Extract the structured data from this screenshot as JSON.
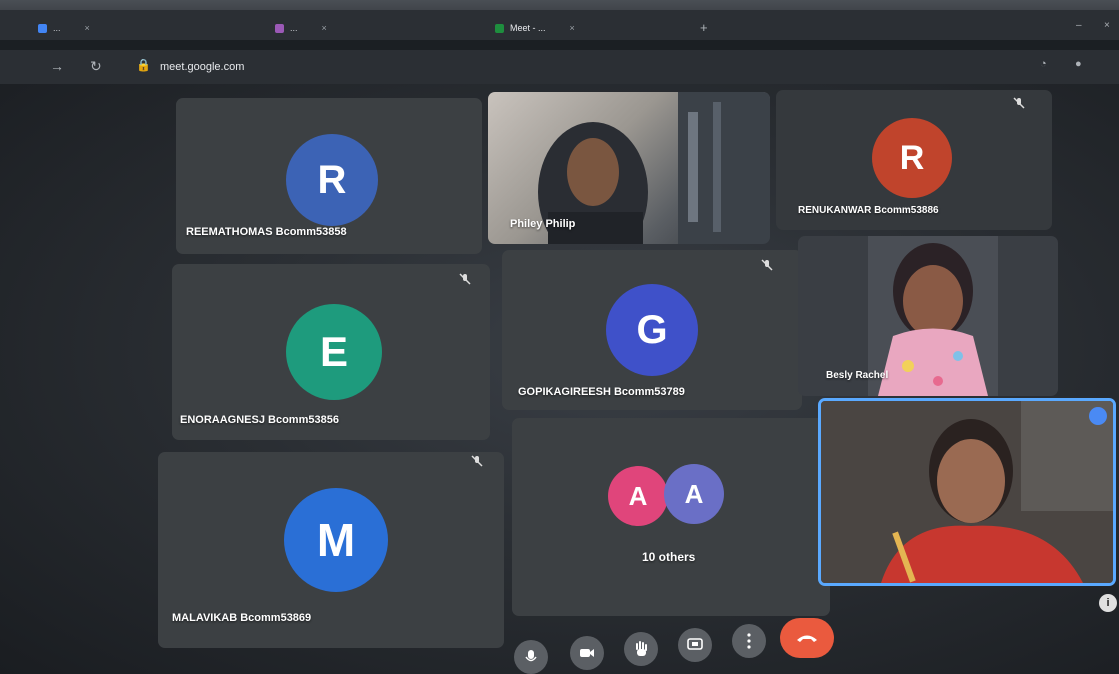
{
  "browser": {
    "tabs": [
      {
        "title": "...",
        "favicon_color": "#4285f4"
      },
      {
        "title": "...",
        "favicon_color": "#9b59b6"
      },
      {
        "title": "Meet - ...",
        "favicon_color": "#1e8e3e"
      }
    ],
    "new_tab_label": "+",
    "url_host": "meet.google.com",
    "window_minimize": "–",
    "window_close": "×"
  },
  "participants": [
    {
      "name": "REEMATHOMAS Bcomm53858",
      "initial": "R",
      "avatar_color": "#3c63b5"
    },
    {
      "name": "Philey Philip"
    },
    {
      "name": "RENUKANWAR Bcomm53886",
      "initial": "R",
      "avatar_color": "#c0442c"
    },
    {
      "name": "ENORAAGNESJ Bcomm53856",
      "initial": "E",
      "avatar_color": "#1e9b7d"
    },
    {
      "name": "GOPIKAGIREESH Bcomm53789",
      "initial": "G",
      "avatar_color": "#3f51c9"
    },
    {
      "name": "Besly Rachel"
    },
    {
      "name": "MALAVIKAB Bcomm53869",
      "initial": "M",
      "avatar_color": "#2a6fd6"
    }
  ],
  "others_tile": {
    "label": "10 others",
    "avatars": [
      {
        "initial": "A",
        "color": "#e0457b"
      },
      {
        "initial": "A",
        "color": "#6a6fc6"
      }
    ]
  },
  "controls": [
    "mic-button",
    "camera-button",
    "raise-hand-button",
    "present-button",
    "more-options-button",
    "end-call-button"
  ],
  "colors": {
    "end_call": "#ea5a3e",
    "tile_bg": "#3c4043",
    "active_border": "#5aa9ff"
  }
}
